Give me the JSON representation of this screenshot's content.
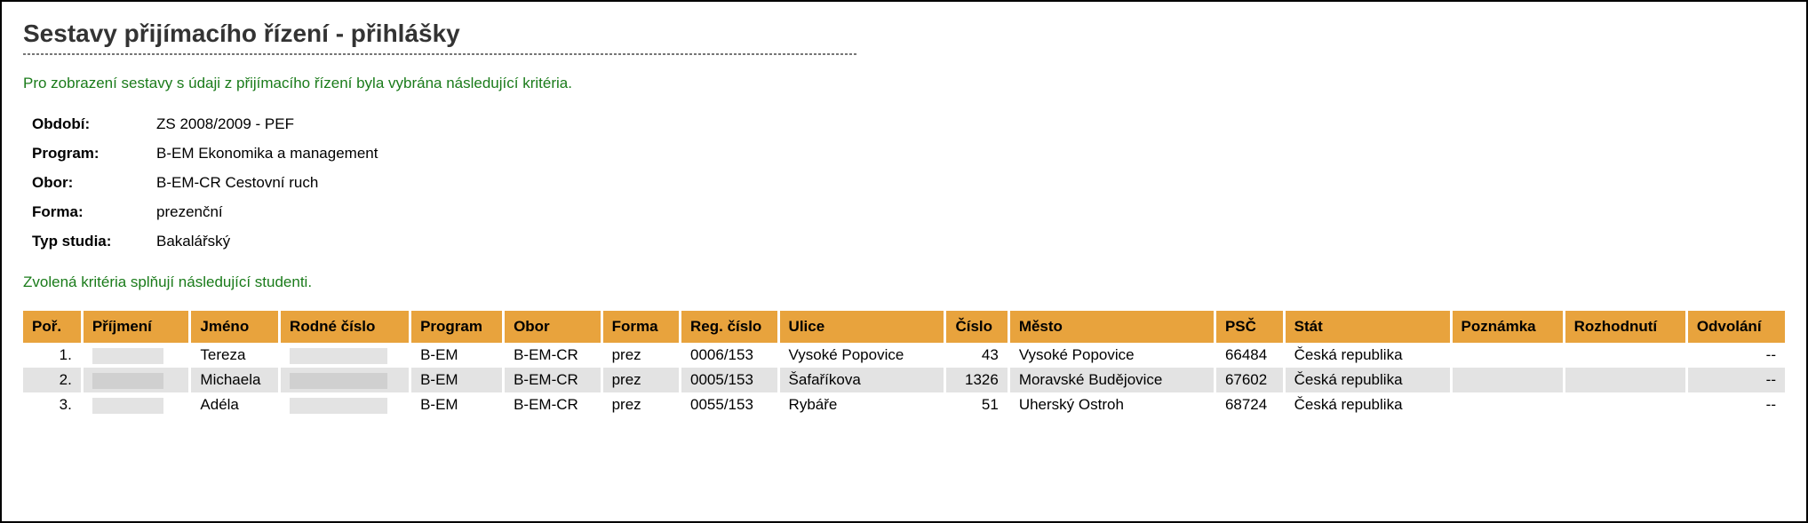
{
  "title": "Sestavy přijímacího řízení - přihlášky",
  "intro": "Pro zobrazení sestavy s údaji z přijímacího řízení byla vybrána následující kritéria.",
  "criteria": {
    "obdobi_label": "Období:",
    "obdobi_value": "ZS 2008/2009 - PEF",
    "program_label": "Program:",
    "program_value": "B-EM Ekonomika a management",
    "obor_label": "Obor:",
    "obor_value": "B-EM-CR Cestovní ruch",
    "forma_label": "Forma:",
    "forma_value": "prezenční",
    "typ_label": "Typ studia:",
    "typ_value": "Bakalářský"
  },
  "subintro": "Zvolená kritéria splňují následující studenti.",
  "columns": {
    "por": "Poř.",
    "prijmeni": "Příjmení",
    "jmeno": "Jméno",
    "rodne_cislo": "Rodné číslo",
    "program": "Program",
    "obor": "Obor",
    "forma": "Forma",
    "reg_cislo": "Reg. číslo",
    "ulice": "Ulice",
    "cislo": "Číslo",
    "mesto": "Město",
    "psc": "PSČ",
    "stat": "Stát",
    "poznamka": "Poznámka",
    "rozhodnuti": "Rozhodnutí",
    "odvolani": "Odvolání"
  },
  "rows": [
    {
      "por": "1.",
      "prijmeni": "",
      "jmeno": "Tereza",
      "rodne_cislo": "",
      "program": "B-EM",
      "obor": "B-EM-CR",
      "forma": "prez",
      "reg_cislo": "0006/153",
      "ulice": "Vysoké Popovice",
      "cislo": "43",
      "mesto": "Vysoké Popovice",
      "psc": "66484",
      "stat": "Česká republika",
      "poznamka": "",
      "rozhodnuti": "",
      "odvolani": "--"
    },
    {
      "por": "2.",
      "prijmeni": "",
      "jmeno": "Michaela",
      "rodne_cislo": "",
      "program": "B-EM",
      "obor": "B-EM-CR",
      "forma": "prez",
      "reg_cislo": "0005/153",
      "ulice": "Šafaříkova",
      "cislo": "1326",
      "mesto": "Moravské Budějovice",
      "psc": "67602",
      "stat": "Česká republika",
      "poznamka": "",
      "rozhodnuti": "",
      "odvolani": "--"
    },
    {
      "por": "3.",
      "prijmeni": "",
      "jmeno": "Adéla",
      "rodne_cislo": "",
      "program": "B-EM",
      "obor": "B-EM-CR",
      "forma": "prez",
      "reg_cislo": "0055/153",
      "ulice": "Rybáře",
      "cislo": "51",
      "mesto": "Uherský Ostroh",
      "psc": "68724",
      "stat": "Česká republika",
      "poznamka": "",
      "rozhodnuti": "",
      "odvolani": "--"
    }
  ]
}
